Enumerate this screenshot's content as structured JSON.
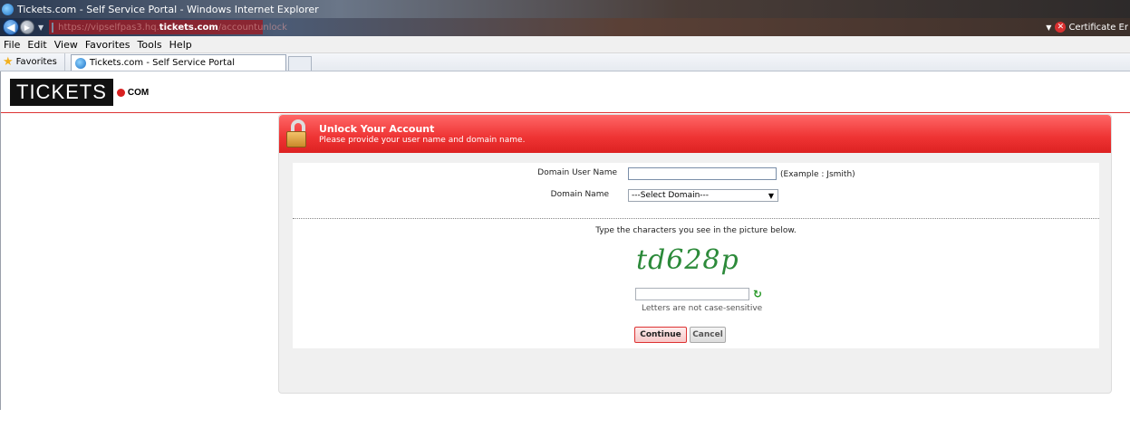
{
  "window": {
    "title": "Tickets.com - Self Service Portal - Windows Internet Explorer"
  },
  "address": {
    "url_prefix": "https://vipselfpas3.hq.",
    "url_host": "tickets.com",
    "url_path": "/accountunlock",
    "certificate": "Certificate Er"
  },
  "menu": [
    "File",
    "Edit",
    "View",
    "Favorites",
    "Tools",
    "Help"
  ],
  "favorites": {
    "label": "Favorites",
    "tab_title": "Tickets.com - Self Service Portal"
  },
  "logo": {
    "main": "TICKETS",
    "suffix": "COM"
  },
  "panel": {
    "title": "Unlock Your Account",
    "subtitle": "Please provide your user name and domain name."
  },
  "form": {
    "user_label": "Domain User Name",
    "user_value": "",
    "user_hint": "(Example : Jsmith)",
    "domain_label": "Domain Name",
    "domain_selected": "---Select Domain---"
  },
  "captcha": {
    "instruction": "Type the characters you see in the picture below.",
    "image_text": "td628p",
    "input_value": "",
    "note": "Letters are not case-sensitive"
  },
  "buttons": {
    "continue": "Continue",
    "cancel": "Cancel"
  },
  "colors": {
    "brand_red": "#e33333",
    "captcha_green": "#2c8a3a"
  }
}
